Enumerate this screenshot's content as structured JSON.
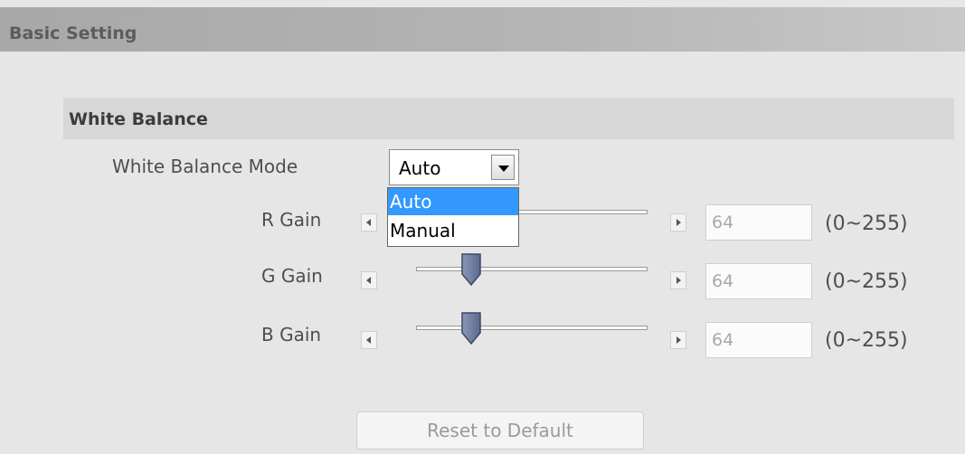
{
  "header": {
    "title": "Basic Setting"
  },
  "white_balance": {
    "section_title": "White Balance",
    "mode_label": "White Balance Mode",
    "mode_selected": "Auto",
    "mode_options": [
      "Auto",
      "Manual"
    ],
    "highlighted_option": "Auto",
    "gains": [
      {
        "label": "R Gain",
        "value": "64",
        "range": "(0~255)"
      },
      {
        "label": "G Gain",
        "value": "64",
        "range": "(0~255)"
      },
      {
        "label": "B Gain",
        "value": "64",
        "range": "(0~255)"
      }
    ]
  },
  "footer": {
    "reset_label": "Reset to Default"
  },
  "colors": {
    "highlight": "#3399ff",
    "header_bg": "#b0b0b0",
    "section_bg": "#d7d7d7",
    "panel_bg": "#e6e6e6"
  }
}
